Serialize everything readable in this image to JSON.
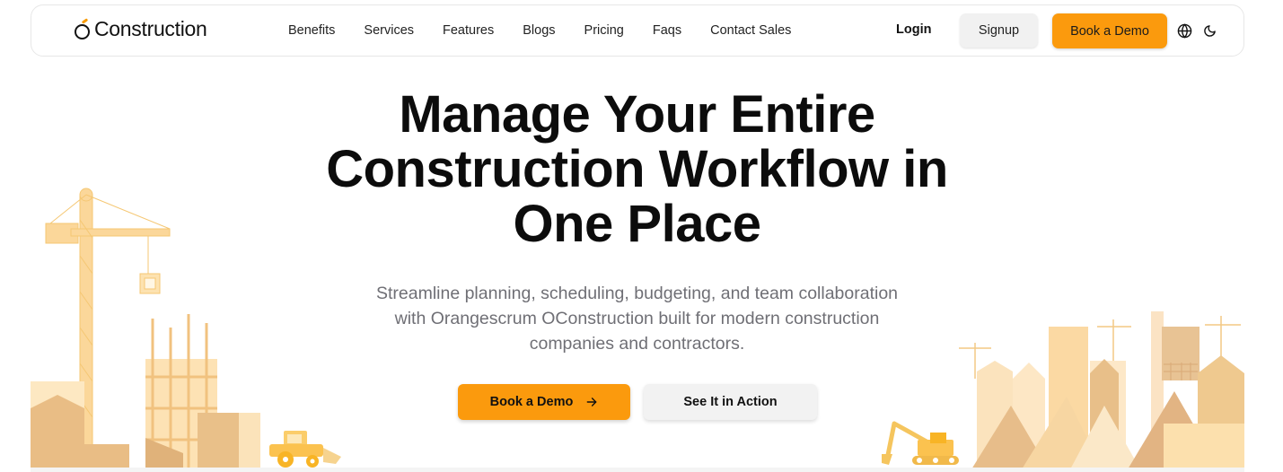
{
  "brand": {
    "name": "Construction"
  },
  "nav": {
    "links": [
      "Benefits",
      "Services",
      "Features",
      "Blogs",
      "Pricing",
      "Faqs",
      "Contact Sales"
    ],
    "login_label": "Login",
    "signup_label": "Signup",
    "demo_label": "Book a Demo",
    "icons": [
      "globe-icon",
      "moon-icon"
    ]
  },
  "hero": {
    "title_lines": [
      "Manage Your Entire",
      "Construction Workflow in",
      "One Place"
    ],
    "subtitle_lines": [
      "Streamline planning, scheduling, budgeting, and team collaboration",
      "with Orangescrum OConstruction built for modern construction",
      "companies and contractors."
    ],
    "primary_cta": "Book a Demo",
    "secondary_cta": "See It in Action"
  },
  "colors": {
    "accent": "#fb9a0d",
    "illustration_light": "#fde8c2",
    "illustration_mid": "#f6cf8a",
    "illustration_dark": "#e6b77a",
    "text_muted": "#6f6f75"
  }
}
